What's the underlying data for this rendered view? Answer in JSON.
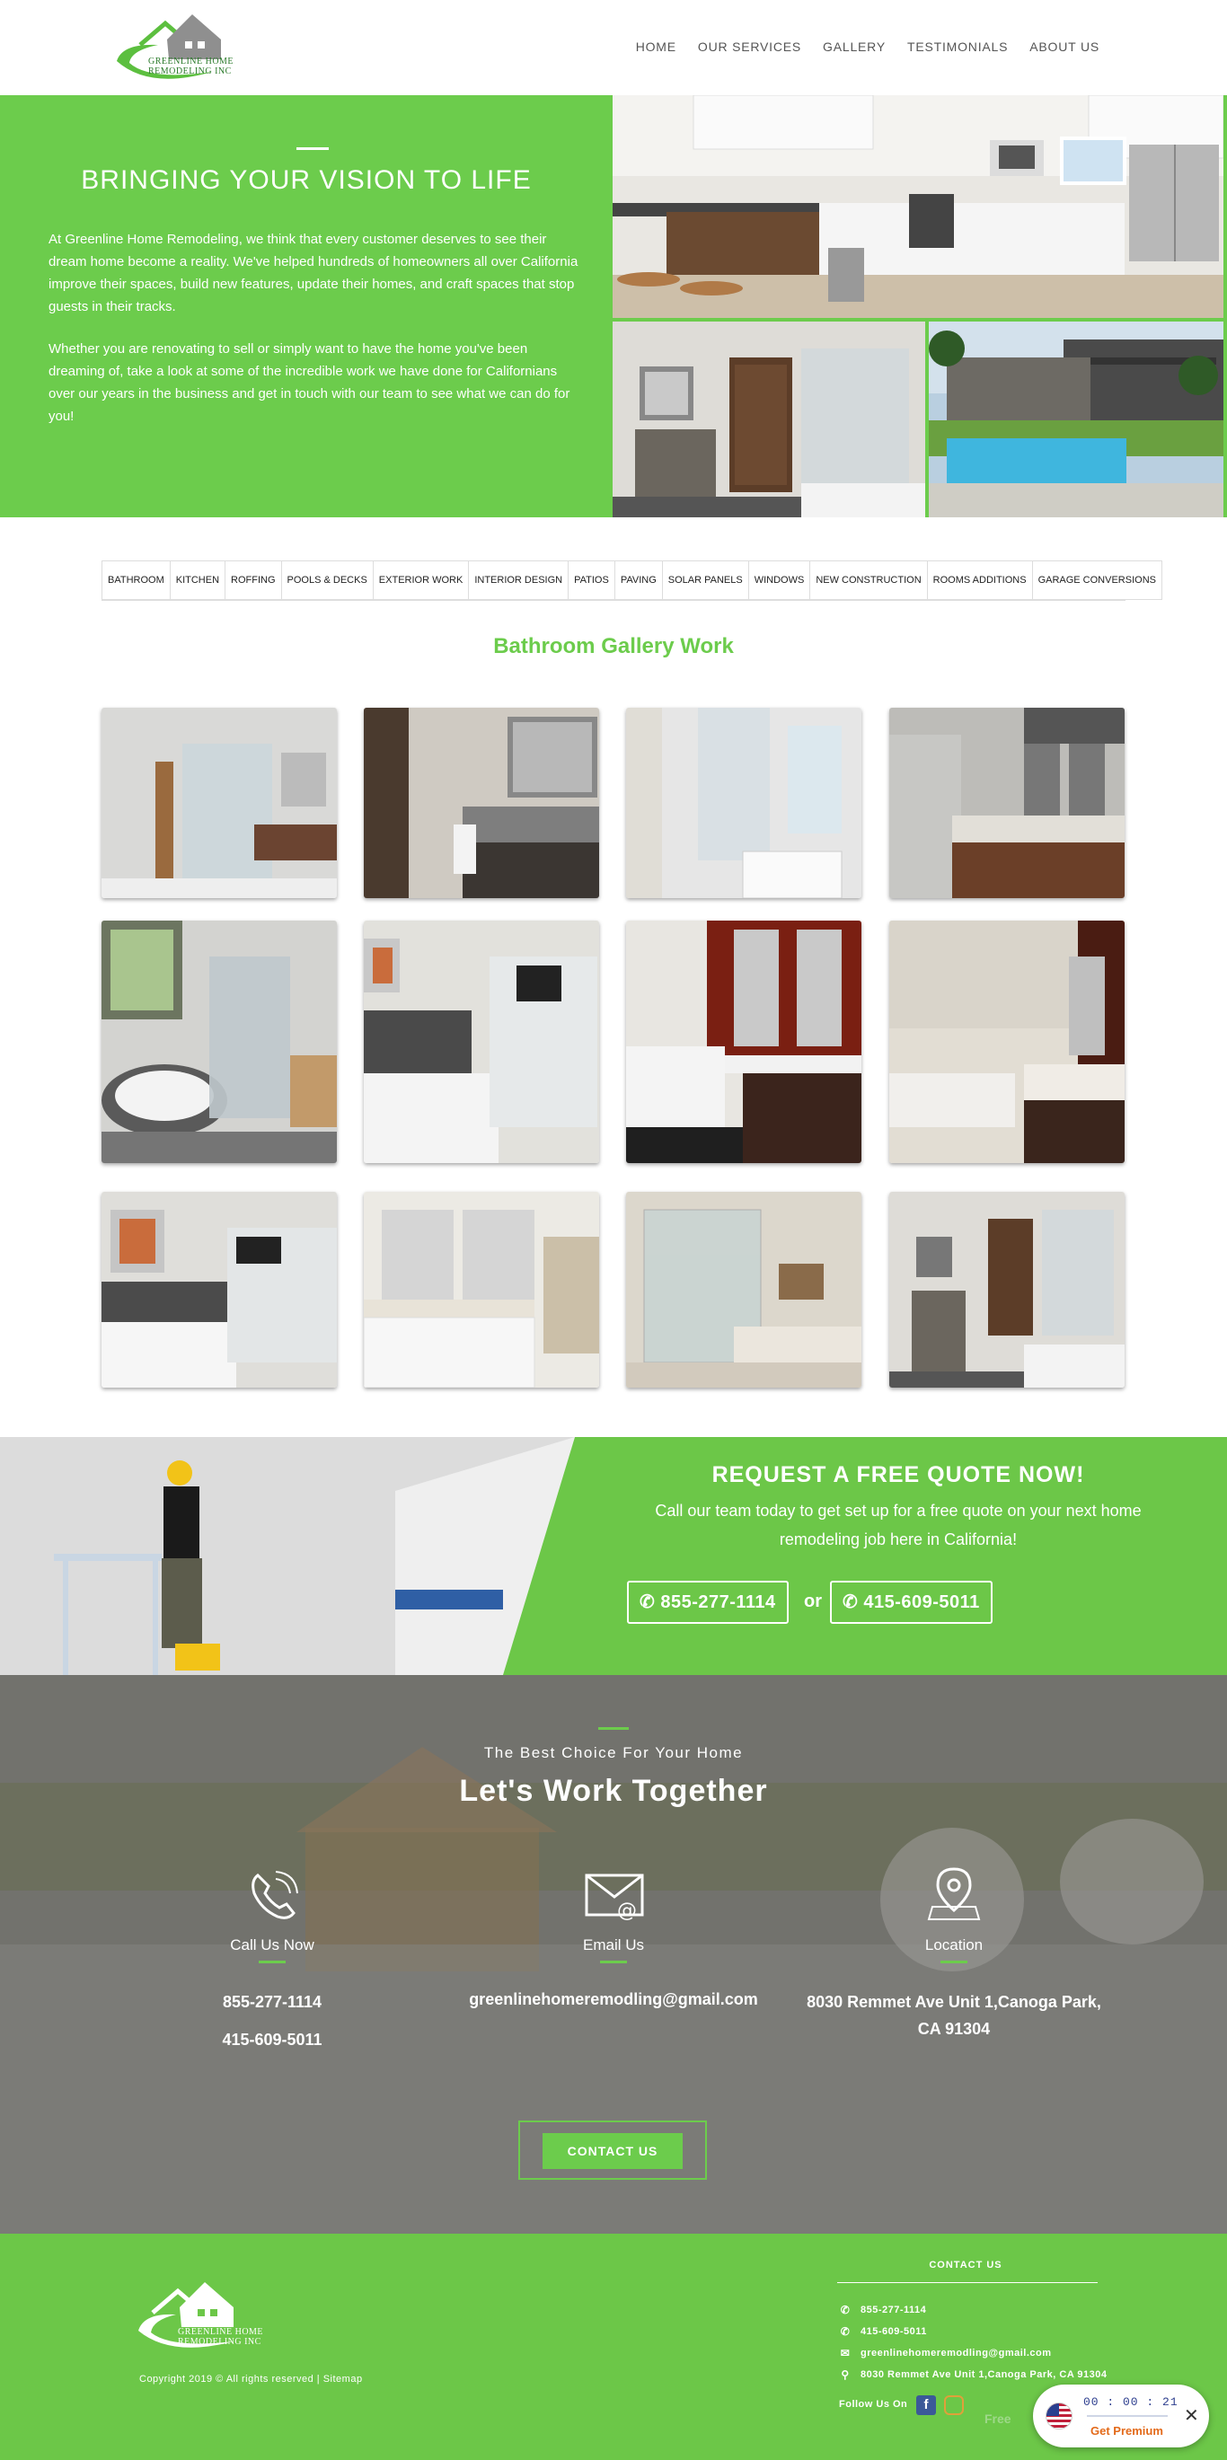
{
  "header": {
    "logo_text_line1": "GREENLINE HOME",
    "logo_text_line2": "REMODELING INC",
    "nav": [
      "HOME",
      "OUR SERVICES",
      "GALLERY",
      "TESTIMONIALS",
      "ABOUT US"
    ]
  },
  "hero": {
    "title": "BRINGING YOUR VISION TO LIFE",
    "paragraph1": "At Greenline Home Remodeling, we think that every customer deserves to see their dream home become a reality. We've helped hundreds of homeowners all over California improve their spaces, build new features, update their homes, and craft spaces that stop guests in their tracks.",
    "paragraph2": "Whether you are renovating to sell or simply want to have the home you've been dreaming of, take a look at some of the incredible work we have done for Californians over our years in the business and get in touch with our team to see what we can do for you!"
  },
  "tabs": [
    "BATHROOM",
    "KITCHEN",
    "ROFFING",
    "POOLS & DECKS",
    "EXTERIOR WORK",
    "INTERIOR DESIGN",
    "PATIOS",
    "PAVING",
    "SOLAR PANELS",
    "WINDOWS",
    "NEW CONSTRUCTION",
    "ROOMS ADDITIONS",
    "GARAGE CONVERSIONS"
  ],
  "gallery": {
    "title": "Bathroom Gallery Work"
  },
  "quote": {
    "title": "REQUEST A FREE QUOTE NOW!",
    "subtitle": "Call our team today to get set up for a free quote on your next home remodeling job here in California!",
    "phone1": "855-277-1114",
    "phone2": "415-609-5011",
    "or": "or"
  },
  "work": {
    "subtitle": "The Best Choice For Your Home",
    "title": "Let's Work Together",
    "call_label": "Call Us Now",
    "call_phone1": "855-277-1114",
    "call_phone2": "415-609-5011",
    "email_label": "Email Us",
    "email": "greenlinehomeremodling@gmail.com",
    "location_label": "Location",
    "address_line1": "8030 Remmet Ave Unit 1,Canoga Park,",
    "address_line2": "CA 91304",
    "contact_button": "CONTACT US"
  },
  "footer": {
    "logo_text_line1": "GREENLINE HOME",
    "logo_text_line2": "REMODELING INC",
    "copyright": "Copyright 2019 © All rights reserved | Sitemap",
    "contact_title": "CONTACT US",
    "phone1": "855-277-1114",
    "phone2": "415-609-5011",
    "email": "greenlinehomeremodling@gmail.com",
    "address": "8030 Remmet Ave Unit 1,Canoga Park, CA 91304",
    "follow": "Follow Us On",
    "free": "Free"
  },
  "widget": {
    "timer": "00 : 00 : 21",
    "get_premium": "Get Premium",
    "close": "✕"
  },
  "colors": {
    "brand_green": "#6ccc4c",
    "nav_text": "#555555",
    "premium_orange": "#e36a1a"
  }
}
